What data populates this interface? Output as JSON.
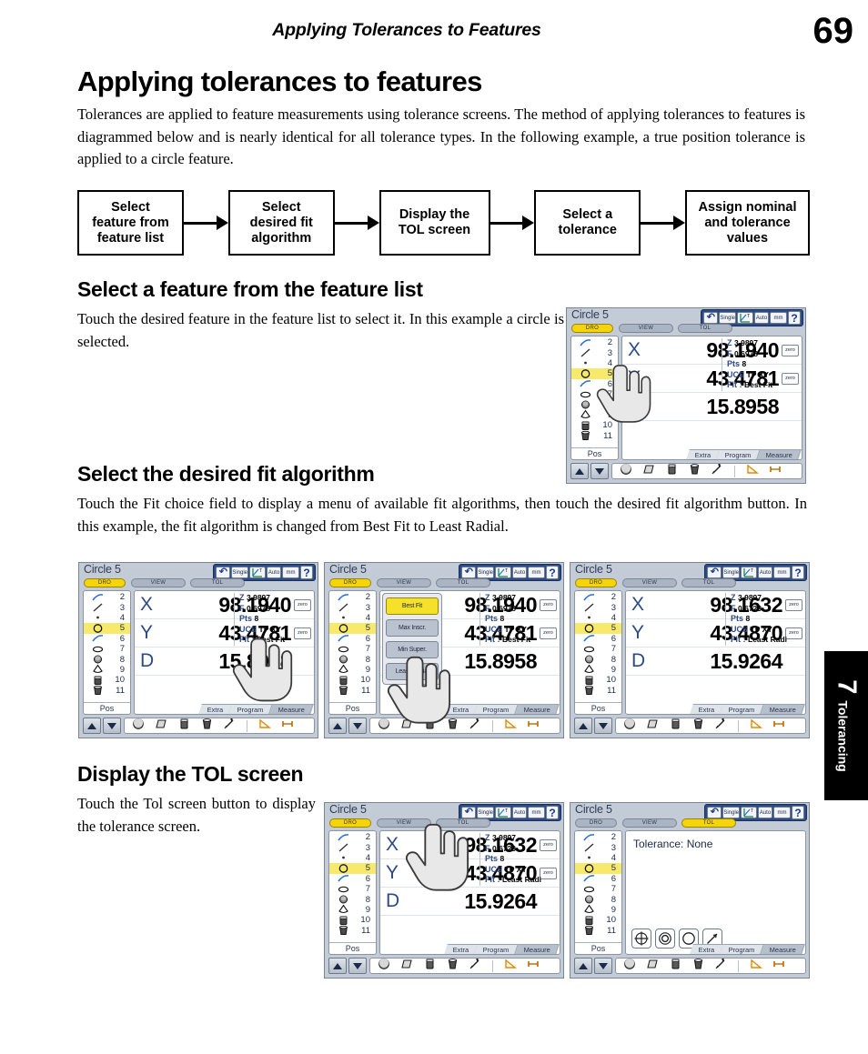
{
  "header": {
    "running_title": "Applying Tolerances to Features",
    "page_number": "69"
  },
  "side_tab": {
    "number": "7",
    "label": "Tolerancing"
  },
  "doc": {
    "title": "Applying tolerances to features",
    "intro": "Tolerances are applied to feature measurements using tolerance screens.  The method of applying tolerances to features is diagrammed below and is nearly identical for all tolerance types. In the following example, a true position tolerance is applied to a circle feature."
  },
  "flow": {
    "steps": [
      "Select\nfeature from\nfeature list",
      "Select\ndesired fit\nalgorithm",
      "Display the\nTOL screen",
      "Select a\ntolerance",
      "Assign nominal\nand tolerance\nvalues"
    ]
  },
  "sections": [
    {
      "heading": "Select a feature from the feature list",
      "body": "Touch the desired feature in the feature list to select it.  In this example a circle is selected."
    },
    {
      "heading": "Select the desired fit algorithm",
      "body": "Touch the Fit choice field to display a menu of available fit algorithms, then touch the desired fit algorithm button.  In this example, the fit algorithm is changed from Best Fit to Least Radial."
    },
    {
      "heading": "Display the TOL screen",
      "body": "Touch the Tol screen button to display the tolerance screen."
    }
  ],
  "dro_common": {
    "title": "Circle 5",
    "toolbar": [
      {
        "name": "undo-icon",
        "label": "↶"
      },
      {
        "name": "single-button",
        "label": "Single"
      },
      {
        "name": "axis-t-icon",
        "label": "T"
      },
      {
        "name": "auto-button",
        "label": "Auto"
      },
      {
        "name": "units-button",
        "label": "mm"
      },
      {
        "name": "help-button",
        "label": "?"
      }
    ],
    "tabs": [
      {
        "name": "tab-dro",
        "label": "DRO"
      },
      {
        "name": "tab-view",
        "label": "VIEW"
      },
      {
        "name": "tab-tol",
        "label": "TOL"
      }
    ],
    "feature_list": [
      {
        "num": "2",
        "icon": "arc-icon"
      },
      {
        "num": "3",
        "icon": "line-icon"
      },
      {
        "num": "4",
        "icon": "point-icon"
      },
      {
        "num": "5",
        "icon": "circle-icon"
      },
      {
        "num": "6",
        "icon": "arc-icon"
      },
      {
        "num": "7",
        "icon": "ellipse-icon"
      },
      {
        "num": "8",
        "icon": "sphere-icon"
      },
      {
        "num": "9",
        "icon": "cone-icon"
      },
      {
        "num": "10",
        "icon": "cylinder-icon"
      },
      {
        "num": "11",
        "icon": "cylinder2-icon"
      }
    ],
    "selected_feature": "5",
    "pos_label": "Pos",
    "zero_label": "zero",
    "crumbs": [
      {
        "label": "Extra",
        "active": false
      },
      {
        "label": "Program",
        "active": false
      },
      {
        "label": "Measure",
        "active": true
      }
    ],
    "footer_icons": [
      "sphere-tool-icon",
      "plane-tool-icon",
      "cylinder-tool-icon",
      "cone-tool-icon",
      "probe-tool-icon",
      "angle-tool-icon",
      "distance-tool-icon"
    ]
  },
  "screens": {
    "s1_select_feature": {
      "axes": [
        {
          "label": "X",
          "value": "98.1940",
          "zero": true
        },
        {
          "label": "Y",
          "value": "43.4781",
          "zero": true
        },
        {
          "label": "",
          "value": "15.8958",
          "zero": false
        }
      ],
      "info": [
        {
          "k": "Z",
          "v": "3.9897"
        },
        {
          "k": "F",
          "v": "0.6978"
        },
        {
          "k": "Pts",
          "v": "8"
        },
        {
          "k": "UCS",
          "v": "TP XY"
        },
        {
          "k": "Fit :",
          "v": "Best Fit"
        }
      ],
      "active_tab": "DRO"
    },
    "s2_best_fit": {
      "axes": [
        {
          "label": "X",
          "value": "98.1940",
          "zero": true
        },
        {
          "label": "Y",
          "value": "43.4781",
          "zero": true
        },
        {
          "label": "D",
          "value": "15.8958",
          "zero": false
        }
      ],
      "info": [
        {
          "k": "Z",
          "v": "3.9897"
        },
        {
          "k": "F",
          "v": "0.6978"
        },
        {
          "k": "Pts",
          "v": "8"
        },
        {
          "k": "UCS",
          "v": "TP XY"
        },
        {
          "k": "Fit :",
          "v": "Best Fit"
        }
      ],
      "active_tab": "DRO"
    },
    "s3_fit_menu": {
      "axes": [
        {
          "label": "",
          "value": "98.1940",
          "zero": true
        },
        {
          "label": "",
          "value": "43.4781",
          "zero": true
        },
        {
          "label": "",
          "value": "15.8958",
          "zero": false
        }
      ],
      "info": [
        {
          "k": "Z",
          "v": "3.9897"
        },
        {
          "k": "F",
          "v": "0.6978"
        },
        {
          "k": "Pts",
          "v": "8"
        },
        {
          "k": "UCS",
          "v": "TP XY"
        },
        {
          "k": "Fit :",
          "v": "Best Fit"
        }
      ],
      "fit_menu": [
        {
          "label": "Best Fit",
          "selected": true
        },
        {
          "label": "Max Inscr.",
          "selected": false
        },
        {
          "label": "Min Super.",
          "selected": false
        },
        {
          "label": "Least Radial",
          "selected": false
        }
      ],
      "active_tab": "DRO"
    },
    "s4_least_radial": {
      "axes": [
        {
          "label": "X",
          "value": "98.1632",
          "zero": true
        },
        {
          "label": "Y",
          "value": "43.4870",
          "zero": true
        },
        {
          "label": "D",
          "value": "15.9264",
          "zero": false
        }
      ],
      "info": [
        {
          "k": "Z",
          "v": "3.9897"
        },
        {
          "k": "F",
          "v": "0.6723"
        },
        {
          "k": "Pts",
          "v": "8"
        },
        {
          "k": "UCS",
          "v": "TP XY"
        },
        {
          "k": "Fit :",
          "v": "Least Radi"
        }
      ],
      "active_tab": "DRO"
    },
    "s5_touch_tol": {
      "axes": [
        {
          "label": "X",
          "value": "98.1632",
          "zero": true
        },
        {
          "label": "Y",
          "value": "43.4870",
          "zero": true
        },
        {
          "label": "D",
          "value": "15.9264",
          "zero": false
        }
      ],
      "info": [
        {
          "k": "Z",
          "v": "3.9897"
        },
        {
          "k": "F",
          "v": "0.6723"
        },
        {
          "k": "Pts",
          "v": "8"
        },
        {
          "k": "UCS",
          "v": "TP XY"
        },
        {
          "k": "Fit :",
          "v": "Least Radi"
        }
      ],
      "active_tab": "DRO"
    },
    "s6_tol_screen": {
      "tolerance_text": "Tolerance: None",
      "tolerance_icons": [
        "true-position-icon",
        "concentricity-icon",
        "roundness-icon",
        "runout-icon"
      ],
      "active_tab": "TOL"
    }
  },
  "colors": {
    "screen_bg": "#c3cbd6",
    "toolbar_blue": "#2c4a86",
    "highlight_yellow": "#f5d40a",
    "axis_blue": "#2c4a86"
  }
}
